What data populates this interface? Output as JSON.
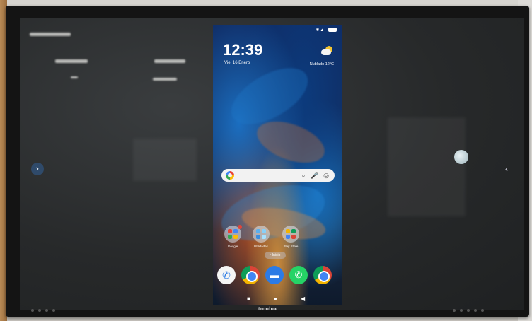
{
  "phone": {
    "status": {
      "carrier": "",
      "battery": "80"
    },
    "lockscreen": {
      "time": "12:39",
      "date": "Vie, 16 Enero",
      "weather": "Nublado  12°C"
    },
    "search_bar": {
      "placeholder": ""
    },
    "home_row": [
      {
        "label": "Google"
      },
      {
        "label": "Utilidades"
      },
      {
        "label": "Play Store"
      }
    ],
    "page_indicator": "• Inicio",
    "dock": [
      {
        "name": "phone-icon"
      },
      {
        "name": "chrome-icon"
      },
      {
        "name": "messages-icon"
      },
      {
        "name": "whatsapp-icon"
      },
      {
        "name": "camera-icon"
      }
    ]
  },
  "monitor": {
    "brand": "trcolux"
  },
  "colors": {
    "accent": "#2f4a6a",
    "wallpaper_blue": "#1b6ec0",
    "wallpaper_orange": "#c98a3a"
  }
}
